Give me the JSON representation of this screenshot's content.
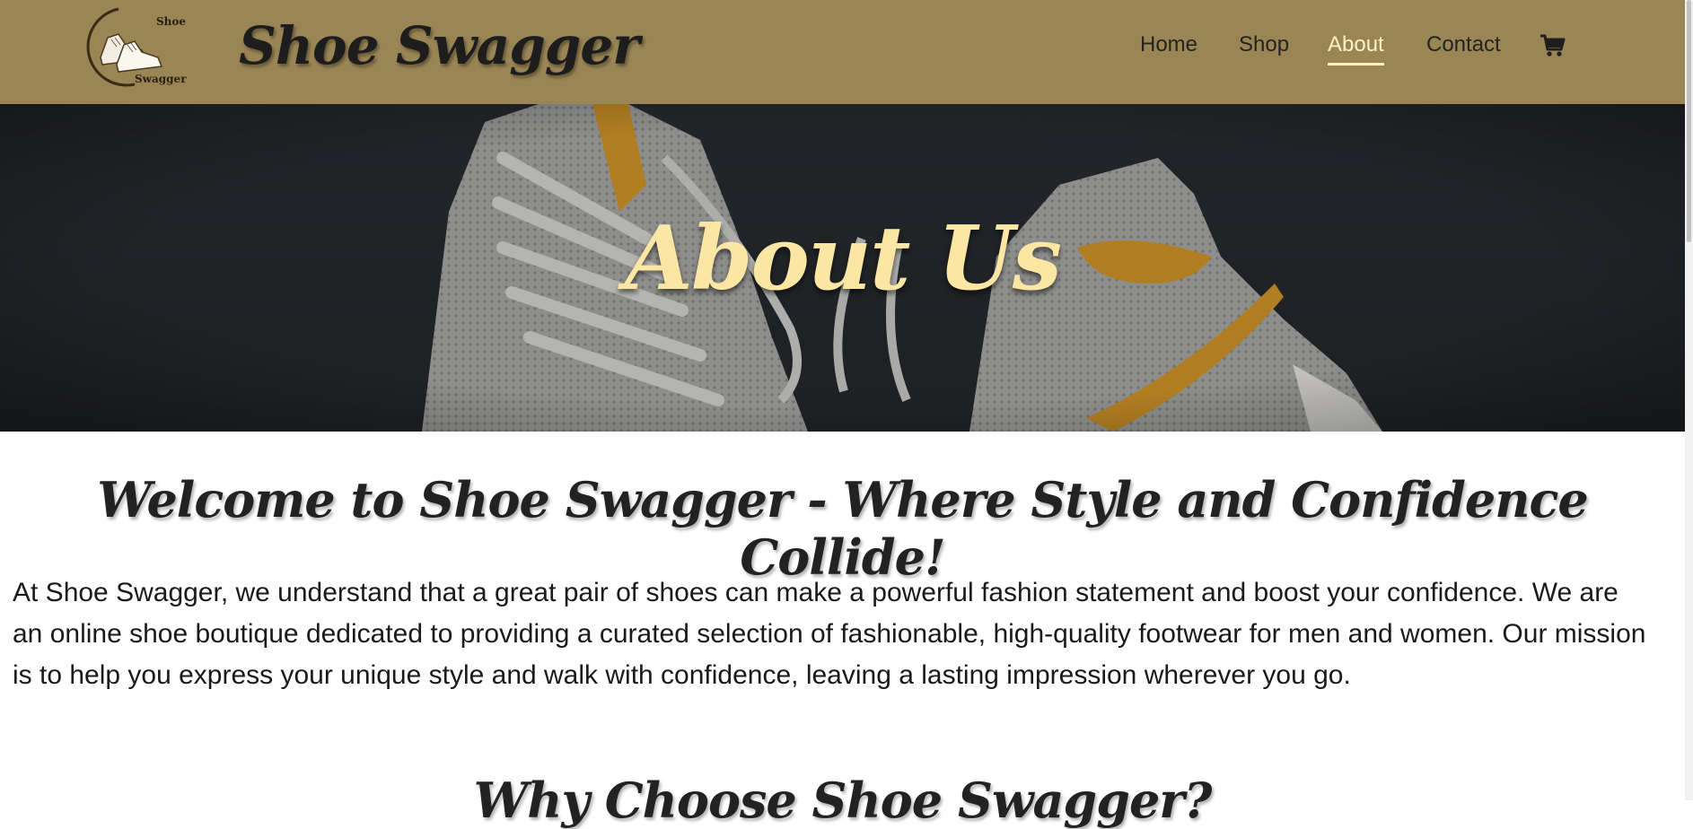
{
  "header": {
    "logo_text_top": "Shoe",
    "logo_text_bottom": "Swagger",
    "brand": "Shoe Swagger",
    "nav": [
      {
        "label": "Home",
        "active": false
      },
      {
        "label": "Shop",
        "active": false
      },
      {
        "label": "About",
        "active": true
      },
      {
        "label": "Contact",
        "active": false
      }
    ],
    "cart_icon": "shopping-cart-icon"
  },
  "hero": {
    "title": "About Us"
  },
  "content": {
    "welcome_heading": "Welcome to Shoe Swagger - Where Style and Confidence Collide!",
    "intro": "At Shoe Swagger, we understand that a great pair of shoes can make a powerful fashion statement and boost your confidence. We are an online shoe boutique dedicated to providing a curated selection of fashionable, high-quality footwear for men and women. Our mission is to help you express your unique style and walk with confidence, leaving a lasting impression wherever you go.",
    "why_heading": "Why Choose Shoe Swagger?"
  },
  "colors": {
    "header_bg": "#9a8555",
    "active_nav": "#fff1c4",
    "hero_title": "#fbe6a3"
  }
}
